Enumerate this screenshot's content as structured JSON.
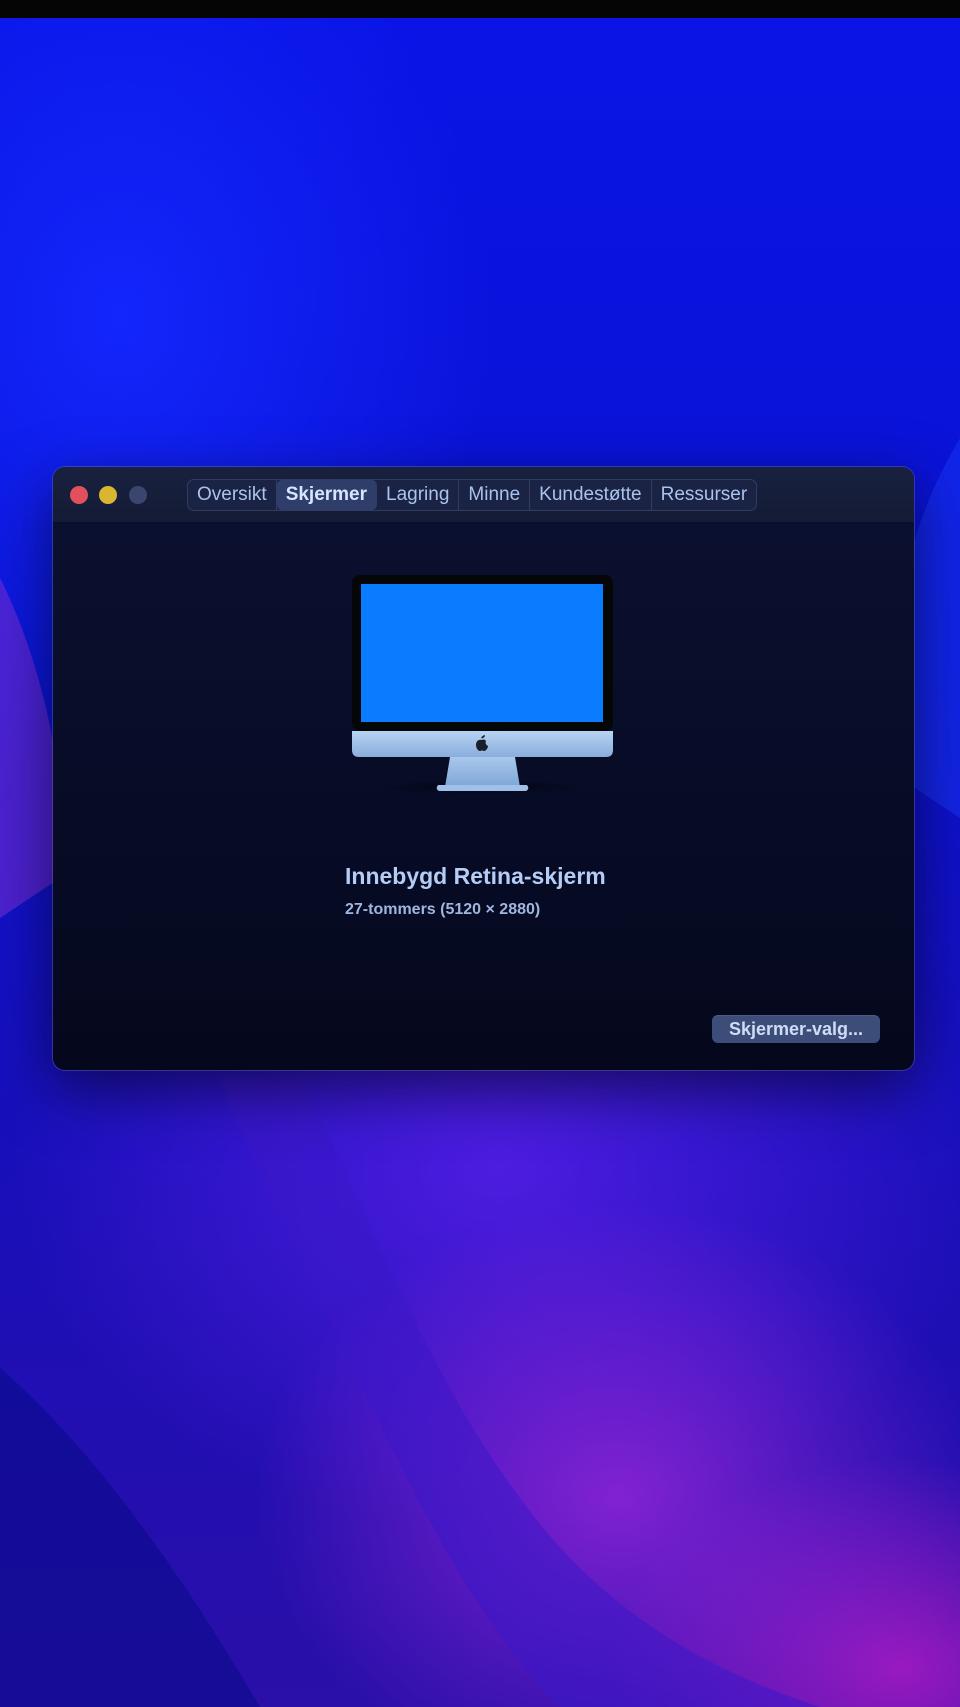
{
  "window": {
    "tabs": [
      {
        "label": "Oversikt",
        "active": false
      },
      {
        "label": "Skjermer",
        "active": true
      },
      {
        "label": "Lagring",
        "active": false
      },
      {
        "label": "Minne",
        "active": false
      },
      {
        "label": "Kundestøtte",
        "active": false
      },
      {
        "label": "Ressurser",
        "active": false
      }
    ],
    "icons": {
      "close": "close-button",
      "minimize": "minimize-button",
      "zoom": "zoom-button",
      "display": "imac-display-icon",
      "logo": "apple-logo-icon"
    }
  },
  "display": {
    "name": "Innebygd Retina-skjerm",
    "size": "27-tommers (5120 × 2880)"
  },
  "actions": {
    "options_label": "Skjermer-valg..."
  },
  "colors": {
    "desktop": "#0b10d8",
    "window_background": "#070b25",
    "active_tab": "#2e3d69",
    "screen_blue": "#0a7cff",
    "close": "#e2505d",
    "minimize": "#d9b531",
    "zoom_inactive": "#3b4670",
    "button": "#3d4d7a"
  }
}
